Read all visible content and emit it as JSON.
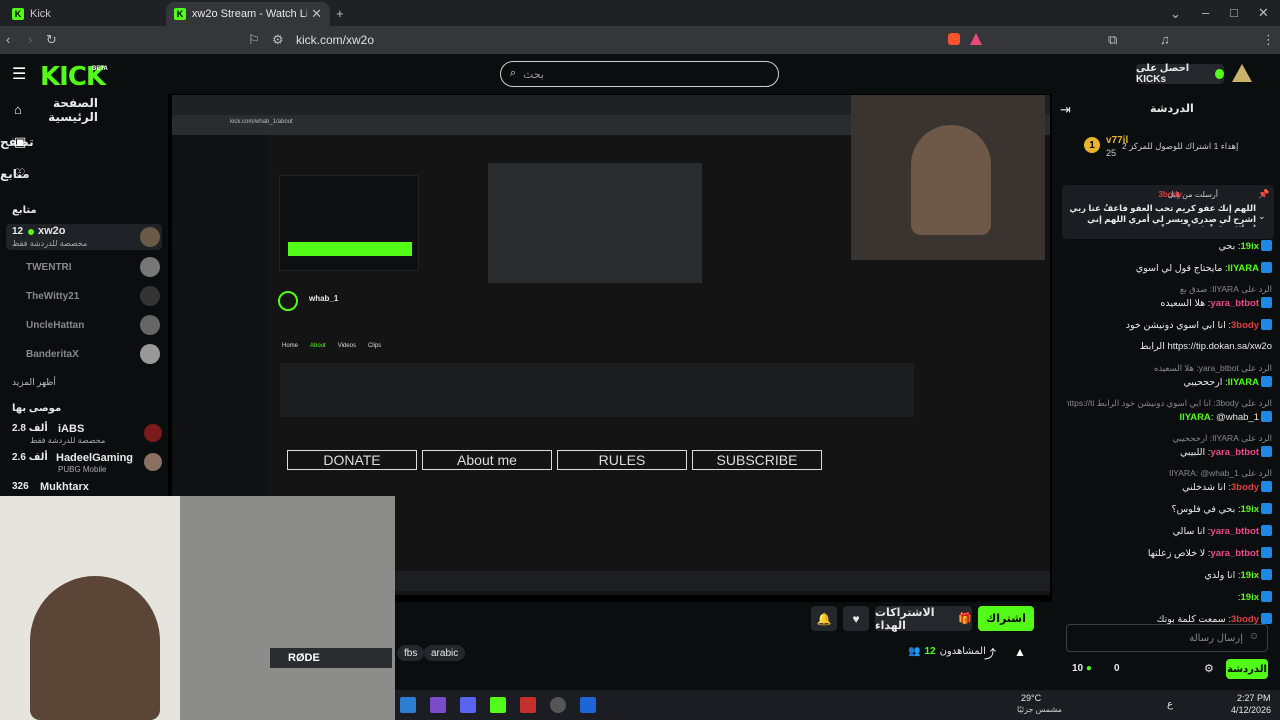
{
  "browser": {
    "tabs": [
      {
        "label": "Kick",
        "active": false
      },
      {
        "label": "xw2o Stream - Watch Live on",
        "active": true
      }
    ],
    "url": "kick.com/xw2o"
  },
  "header": {
    "logo": "KICK",
    "logo_beta": "BETA",
    "search_placeholder": "بحث",
    "get_kicks": "احصل على KICKs"
  },
  "sidebar": {
    "nav": [
      {
        "label": "الصفحة الرئيسية",
        "icon": "home-icon"
      },
      {
        "label": "تصفح",
        "icon": "browse-icon"
      },
      {
        "label": "متابع",
        "icon": "heart-icon"
      }
    ],
    "following_title": "متابع",
    "following": [
      {
        "name": "xw2o",
        "count": "12",
        "sub": "مخصصة للدردشة فقط",
        "live": true
      },
      {
        "name": "TWENTRI",
        "live": false
      },
      {
        "name": "TheWitty21",
        "live": false
      },
      {
        "name": "UncleHattan",
        "live": false
      },
      {
        "name": "BanderitaX",
        "live": false
      }
    ],
    "show_more": "أظهر المزيد",
    "recommended_title": "موصى بها",
    "recommended": [
      {
        "name": "iABS",
        "count": "2.8 ألف",
        "sub": "مخصصة للدردشة فقط"
      },
      {
        "name": "HadeelGaming",
        "count": "2.6 ألف",
        "sub": "PUBG Mobile"
      },
      {
        "name": "Mukhtarx",
        "count": "326",
        "sub": ""
      }
    ]
  },
  "stream": {
    "inner_panels": [
      "DONATE",
      "About me",
      "RULES",
      "SUBSCRIBE"
    ],
    "inner_channel": "whab_1",
    "inner_url": "kick.com/whab_1/about",
    "inner_tabs": [
      "Home",
      "About",
      "Videos",
      "Clips"
    ],
    "mic_label": "RØDE"
  },
  "actions": {
    "subscribe": "اشتراك",
    "gift_subs": "الاشتراكات الهداء",
    "viewers_label": "المشاهدون",
    "viewers": "12",
    "tags": [
      "fbs",
      "arabic"
    ]
  },
  "chat": {
    "title": "الدردشة",
    "leader_name": "v77il",
    "leader_amount": "25",
    "leader_text": "إهداء 1 اشتراك للوصول للمركز 2",
    "pinned_header": "أرسلت من قِبل",
    "pinned_user": "3body",
    "pinned_text": "اللهم إنك عفو كريم تحب العفو فاعفُ عنا ربي اشرح لي صدري ويسر لي أمري اللهم إني أسألك علماً نافعاً ورزقاً",
    "messages": [
      {
        "user": "19ix",
        "text": "بحي",
        "color": "green",
        "reply": ""
      },
      {
        "user": "IlYARA",
        "text": "مايحتاج قول لي اسوي",
        "color": "green",
        "reply": ""
      },
      {
        "user": "yara_btbot",
        "text": "هلا السعيده",
        "color": "pink",
        "reply": "الرد على IlYARA: صدق بع"
      },
      {
        "user": "3body",
        "text": "انا ابي اسوي دونيشن خود",
        "color": "red",
        "reply": ""
      },
      {
        "user": "",
        "text": "https://tip.dokan.sa/xw2o الرابط",
        "color": "",
        "reply": ""
      },
      {
        "user": "IlYARA",
        "text": "ارحححيبي",
        "color": "green",
        "reply": "الرد على yara_btbot: هلا السعيده"
      },
      {
        "user": "IlYARA",
        "text": "@whab_1",
        "color": "green",
        "reply": "الرد على 3body: انا ابي اسوي دونيشن خود الرابط https://ti"
      },
      {
        "user": "yara_btbot",
        "text": "اللبيبي",
        "color": "pink",
        "reply": "الرد على IlYARA: ارحححيبي"
      },
      {
        "user": "3body",
        "text": "انا شدخلني",
        "color": "red",
        "reply": "الرد على IlYARA: @whab_1"
      },
      {
        "user": "19ix",
        "text": "بحي في فلوس؟",
        "color": "green",
        "reply": ""
      },
      {
        "user": "yara_btbot",
        "text": "انا سالي",
        "color": "pink",
        "reply": ""
      },
      {
        "user": "yara_btbot",
        "text": "لا خلاص زعلتها",
        "color": "pink",
        "reply": ""
      },
      {
        "user": "19ix",
        "text": "انا ولدي",
        "color": "green",
        "reply": ""
      },
      {
        "user": "19ix",
        "text": "",
        "color": "green",
        "reply": ""
      },
      {
        "user": "3body",
        "text": "سمعت كلمة بوتك",
        "color": "red",
        "reply": ""
      }
    ],
    "input_placeholder": "إرسال رسالة",
    "points": "10",
    "zero": "0",
    "chat_button": "الدردشة"
  },
  "taskbar": {
    "temp": "29°C",
    "weather": "مشمس جزئيًا",
    "time": "2:27 PM",
    "date": "4/12/2026",
    "lang": "ع"
  },
  "colors": {
    "brand": "#53fc18",
    "bg": "#0b0e0f",
    "panel": "#24272c"
  }
}
